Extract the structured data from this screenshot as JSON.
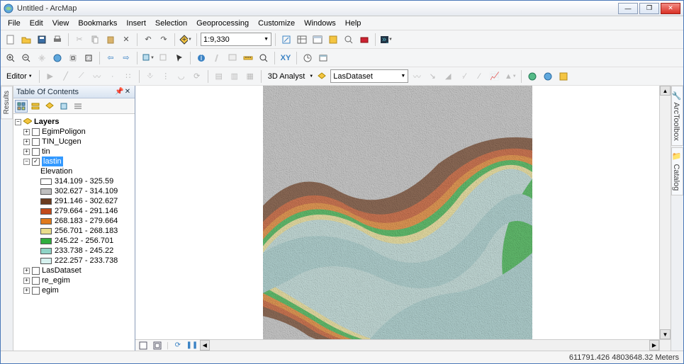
{
  "window": {
    "title": "Untitled - ArcMap"
  },
  "menu": {
    "items": [
      "File",
      "Edit",
      "View",
      "Bookmarks",
      "Insert",
      "Selection",
      "Geoprocessing",
      "Customize",
      "Windows",
      "Help"
    ]
  },
  "toolbar1": {
    "scale": "1:9,330"
  },
  "toolbar3": {
    "editor_label": "Editor",
    "analyst_label": "3D Analyst",
    "las_label": "LasDataset"
  },
  "left_tabs": {
    "results": "Results"
  },
  "right_tabs": {
    "toolbox": "ArcToolbox",
    "catalog": "Catalog"
  },
  "toc": {
    "title": "Table Of Contents",
    "root": "Layers",
    "layers": [
      {
        "name": "EgimPoligon",
        "checked": false
      },
      {
        "name": "TIN_Ucgen",
        "checked": false
      },
      {
        "name": "tin",
        "checked": false
      },
      {
        "name": "lastin",
        "checked": true,
        "selected": true,
        "expanded": true,
        "heading": "Elevation",
        "classes": [
          {
            "label": "314.109 - 325.59",
            "color": "#ffffff"
          },
          {
            "label": "302.627 - 314.109",
            "color": "#bfbfbf"
          },
          {
            "label": "291.146 - 302.627",
            "color": "#6b3b1f"
          },
          {
            "label": "279.664 - 291.146",
            "color": "#c24a19"
          },
          {
            "label": "268.183 - 279.664",
            "color": "#e07a1c"
          },
          {
            "label": "256.701 - 268.183",
            "color": "#e9dc8b"
          },
          {
            "label": "245.22 - 256.701",
            "color": "#2fae3f"
          },
          {
            "label": "233.738 - 245.22",
            "color": "#8fd4c6"
          },
          {
            "label": "222.257 - 233.738",
            "color": "#d6f2ef"
          }
        ]
      },
      {
        "name": "LasDataset",
        "checked": false
      },
      {
        "name": "re_egim",
        "checked": false
      },
      {
        "name": "egim",
        "checked": false
      }
    ]
  },
  "status": {
    "coords": "611791.426 4803648.32 Meters"
  },
  "chart_data": {
    "type": "area",
    "title": "Elevation (lastin TIN hillshade)",
    "series": [
      {
        "name": "Elevation",
        "values": []
      }
    ],
    "legend_classes": [
      {
        "range": [
          314.109,
          325.59
        ],
        "color": "#ffffff"
      },
      {
        "range": [
          302.627,
          314.109
        ],
        "color": "#bfbfbf"
      },
      {
        "range": [
          291.146,
          302.627
        ],
        "color": "#6b3b1f"
      },
      {
        "range": [
          279.664,
          291.146
        ],
        "color": "#c24a19"
      },
      {
        "range": [
          268.183,
          279.664
        ],
        "color": "#e07a1c"
      },
      {
        "range": [
          256.701,
          268.183
        ],
        "color": "#e9dc8b"
      },
      {
        "range": [
          245.22,
          256.701
        ],
        "color": "#2fae3f"
      },
      {
        "range": [
          233.738,
          245.22
        ],
        "color": "#8fd4c6"
      },
      {
        "range": [
          222.257,
          233.738
        ],
        "color": "#d6f2ef"
      }
    ],
    "ylim": [
      222.257,
      325.59
    ]
  }
}
